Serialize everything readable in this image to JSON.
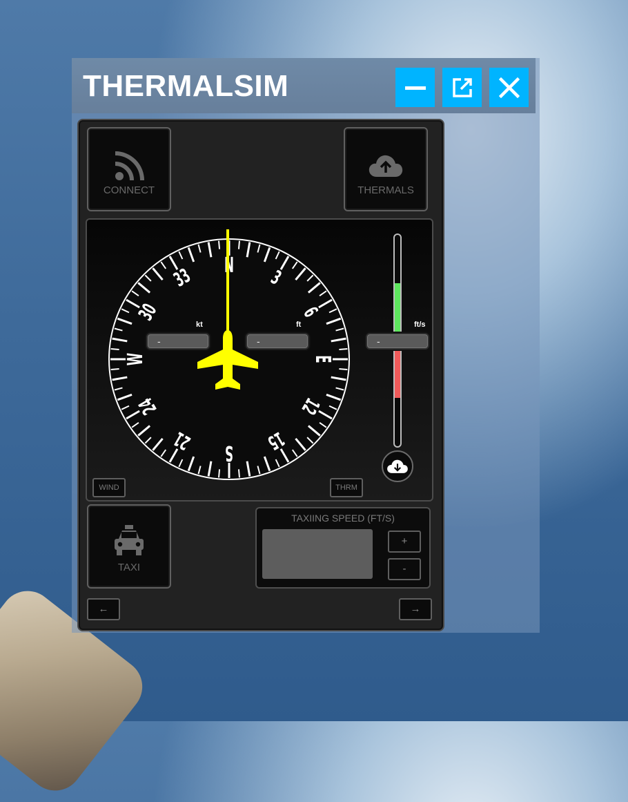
{
  "app": {
    "title": "THERMALSIM"
  },
  "titlebar": {
    "buttons": [
      {
        "name": "minimize",
        "icon": "minus-icon"
      },
      {
        "name": "popout",
        "icon": "external-link-icon"
      },
      {
        "name": "close",
        "icon": "close-icon"
      }
    ],
    "accent": "#00b4ff"
  },
  "buttons": {
    "connect": {
      "label": "CONNECT",
      "icon": "rss-icon"
    },
    "thermals": {
      "label": "THERMALS",
      "icon": "cloud-upload-icon"
    },
    "taxi": {
      "label": "TAXI",
      "icon": "taxi-icon"
    },
    "wind": {
      "label": "WIND"
    },
    "thrm": {
      "label": "THRM"
    },
    "prev": {
      "label": "←"
    },
    "next": {
      "label": "→"
    }
  },
  "compass": {
    "cardinals": {
      "N": "N",
      "E": "E",
      "S": "S",
      "W": "W"
    },
    "numbers": [
      "3",
      "6",
      "12",
      "15",
      "21",
      "24",
      "30",
      "33"
    ],
    "heading_color": "#ffff00",
    "aircraft_color": "#ffff00"
  },
  "readouts": {
    "wind": {
      "unit": "kt",
      "value": "-"
    },
    "altitude": {
      "unit": "ft",
      "value": "-"
    },
    "vario": {
      "unit": "ft/s",
      "value": "-"
    }
  },
  "vario_bar": {
    "positive_color": "#5ee65e",
    "negative_color": "#f05a5a"
  },
  "vario_button": {
    "icon": "cloud-download-icon"
  },
  "taxi_speed": {
    "header": "TAXIING SPEED (FT/S)",
    "value": "",
    "plus_label": "+",
    "minus_label": "-"
  }
}
